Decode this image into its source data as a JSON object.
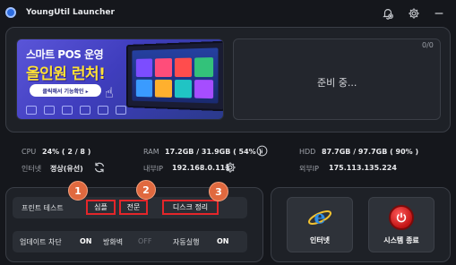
{
  "window": {
    "title": "YoungUtil Launcher"
  },
  "banner": {
    "line1": "스마트 POS 운영",
    "line2": "올인원 런처!",
    "cta": "클릭해서 기능확인 ▸"
  },
  "status": {
    "count": "0/0",
    "message": "준비 중..."
  },
  "system": {
    "cpu_label": "CPU",
    "cpu_value": "24% ( 2 / 8 )",
    "ram_label": "RAM",
    "ram_value": "17.2GB / 31.9GB ( 54% )",
    "hdd_label": "HDD",
    "hdd_value": "87.7GB / 97.7GB ( 90% )",
    "internet_label": "인터넷",
    "internet_value": "정상(유선)",
    "internal_ip_label": "내부IP",
    "internal_ip_value": "192.168.0.111",
    "external_ip_label": "외부IP",
    "external_ip_value": "175.113.135.224"
  },
  "print_test": {
    "label": "프린트 테스트",
    "options": [
      "심플",
      "전문",
      "디스크 정리"
    ],
    "badges": [
      "1",
      "2",
      "3"
    ]
  },
  "toggles": {
    "update_block_label": "업데이트 차단",
    "update_block_value": "ON",
    "firewall_label": "방화벽",
    "firewall_value": "OFF",
    "autorun_label": "자동실행",
    "autorun_value": "ON"
  },
  "actions": {
    "internet_label": "인터넷",
    "shutdown_label": "시스템 종료"
  },
  "colors": {
    "background": "#15171c",
    "panel": "#1e2127",
    "highlight_border": "#e4262a",
    "badge": "#e0693f",
    "banner": "#4a47cc",
    "banner_accent": "#ffe135"
  },
  "icons": {
    "app": "app-logo-icon",
    "notification": "bell-off-icon",
    "settings": "gear-icon",
    "minimize": "minimize-icon",
    "info": "info-icon",
    "refresh": "refresh-icon",
    "ip_settings": "gear-icon",
    "internet": "internet-explorer-icon",
    "power": "power-icon"
  }
}
